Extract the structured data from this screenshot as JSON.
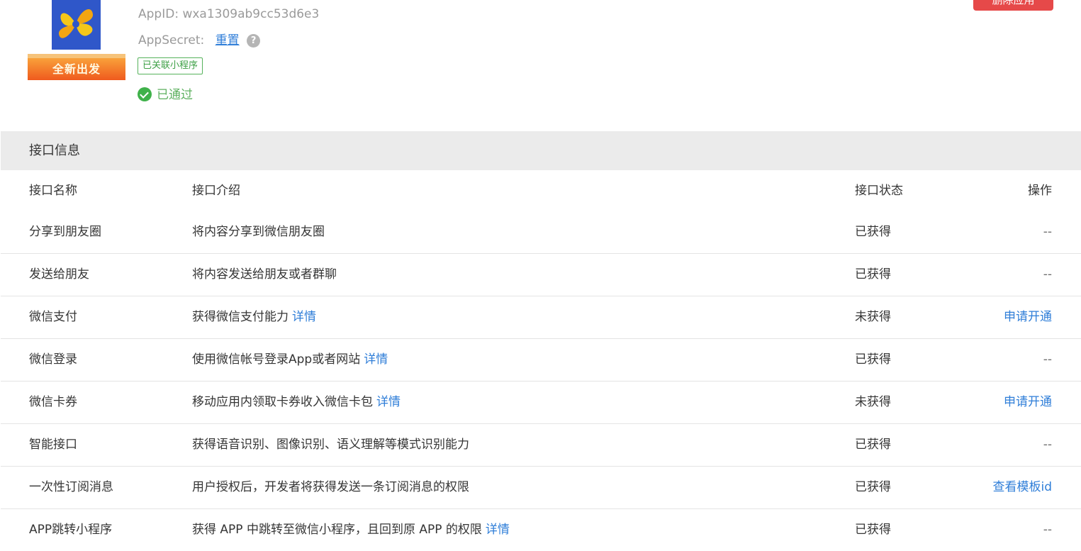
{
  "app": {
    "logo_text": "全新出发",
    "appid_label": "AppID:",
    "appid_value": "wxa1309ab9cc53d6e3",
    "secret_label": "AppSecret:",
    "reset_label": "重置",
    "help_glyph": "?",
    "linked_tag": "已关联小程序",
    "status_text": "已通过",
    "status_color": "#5db05f",
    "delete_label": "删除应用"
  },
  "interfaces": {
    "section_title": "接口信息",
    "columns": {
      "name": "接口名称",
      "desc": "接口介绍",
      "status": "接口状态",
      "action": "操作"
    },
    "rows": [
      {
        "name": "分享到朋友圈",
        "desc": "将内容分享到微信朋友圈",
        "detail": "",
        "status": "已获得",
        "action": "--"
      },
      {
        "name": "发送给朋友",
        "desc": "将内容发送给朋友或者群聊",
        "detail": "",
        "status": "已获得",
        "action": "--"
      },
      {
        "name": "微信支付",
        "desc": "获得微信支付能力",
        "detail": "详情",
        "status": "未获得",
        "action": "申请开通"
      },
      {
        "name": "微信登录",
        "desc": "使用微信帐号登录App或者网站",
        "detail": "详情",
        "status": "已获得",
        "action": "--"
      },
      {
        "name": "微信卡券",
        "desc": "移动应用内领取卡券收入微信卡包",
        "detail": "详情",
        "status": "未获得",
        "action": "申请开通"
      },
      {
        "name": "智能接口",
        "desc": "获得语音识别、图像识别、语义理解等模式识别能力",
        "detail": "",
        "status": "已获得",
        "action": "--"
      },
      {
        "name": "一次性订阅消息",
        "desc": "用户授权后，开发者将获得发送一条订阅消息的权限",
        "detail": "",
        "status": "已获得",
        "action": "查看模板id"
      },
      {
        "name": "APP跳转小程序",
        "desc": "获得 APP 中跳转至微信小程序，且回到原 APP 的权限",
        "detail": "详情",
        "status": "已获得",
        "action": "--"
      }
    ]
  },
  "colors": {
    "link": "#2f7ed8",
    "danger": "#e64949",
    "section_bg": "#ebebeb"
  }
}
